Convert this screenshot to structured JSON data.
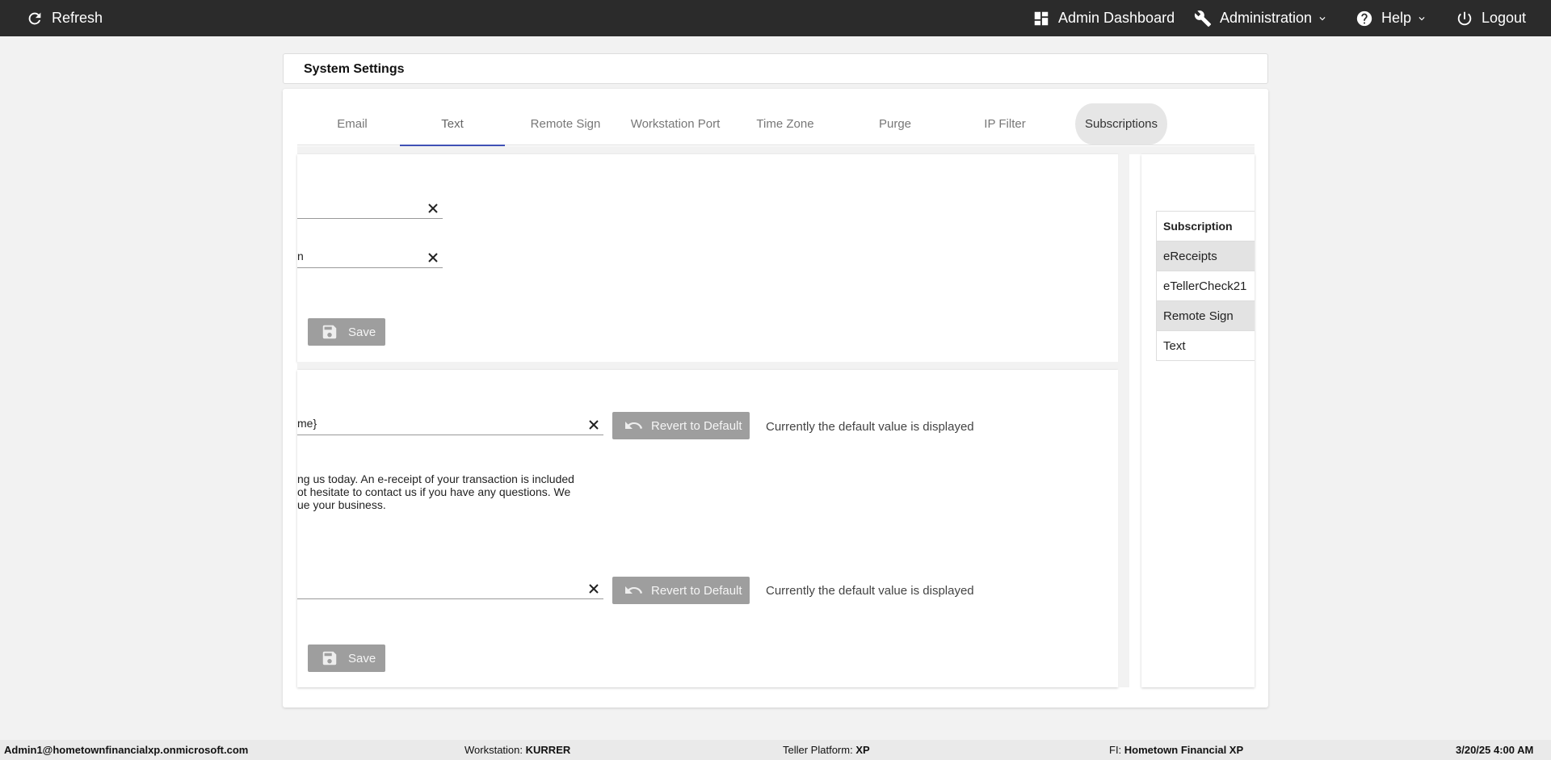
{
  "topbar": {
    "refresh": "Refresh",
    "admin_dashboard": "Admin Dashboard",
    "administration": "Administration",
    "help": "Help",
    "logout": "Logout"
  },
  "header": {
    "title": "System Settings"
  },
  "tabs": [
    {
      "label": "Email"
    },
    {
      "label": "Text"
    },
    {
      "label": "Remote Sign"
    },
    {
      "label": "Workstation Port"
    },
    {
      "label": "Time Zone"
    },
    {
      "label": "Purge"
    },
    {
      "label": "IP Filter"
    },
    {
      "label": "Subscriptions"
    }
  ],
  "panel1": {
    "field1_value": "",
    "field2_value": "n",
    "save_label": "Save"
  },
  "panel2": {
    "field1_value": "me}",
    "revert_label": "Revert to Default",
    "note": "Currently the default value is displayed",
    "body_lines": [
      "ng us today. An e-receipt of your transaction is included",
      "ot hesitate to contact us if you have any questions. We",
      "ue your business."
    ],
    "field2_value": "",
    "save_label": "Save"
  },
  "subscriptions": {
    "header": "Subscription",
    "items": [
      "eReceipts",
      "eTellerCheck21",
      "Remote Sign",
      "Text"
    ]
  },
  "statusbar": {
    "user": "Admin1@hometownfinancialxp.onmicrosoft.com",
    "workstation_label": "Workstation:",
    "workstation_value": "KURRER",
    "platform_label": "Teller Platform:",
    "platform_value": "XP",
    "fi_label": "FI:",
    "fi_value": "Hometown Financial XP",
    "datetime": "3/20/25 4:00 AM"
  },
  "colors": {
    "topbar": "#2b2b2b",
    "tab_active_underline": "#3f51b5",
    "button_disabled": "#9e9e9e",
    "row_shade": "#e3e3e3"
  }
}
